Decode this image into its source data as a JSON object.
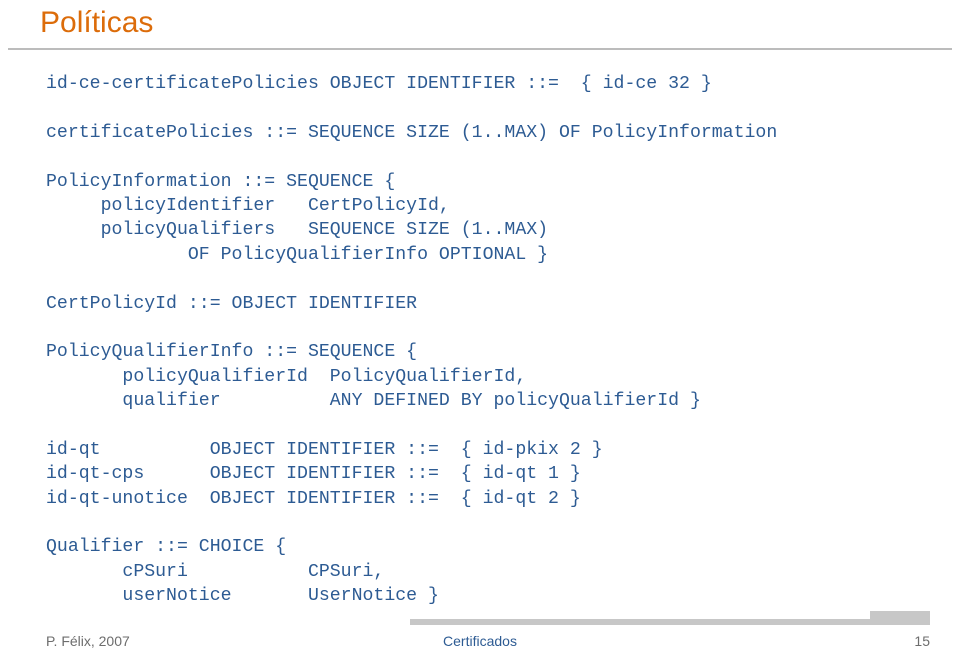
{
  "title": "Políticas",
  "code": "id-ce-certificatePolicies OBJECT IDENTIFIER ::=  { id-ce 32 }\n\ncertificatePolicies ::= SEQUENCE SIZE (1..MAX) OF PolicyInformation\n\nPolicyInformation ::= SEQUENCE {\n     policyIdentifier   CertPolicyId,\n     policyQualifiers   SEQUENCE SIZE (1..MAX)\n             OF PolicyQualifierInfo OPTIONAL }\n\nCertPolicyId ::= OBJECT IDENTIFIER\n\nPolicyQualifierInfo ::= SEQUENCE {\n       policyQualifierId  PolicyQualifierId,\n       qualifier          ANY DEFINED BY policyQualifierId }\n\nid-qt          OBJECT IDENTIFIER ::=  { id-pkix 2 }\nid-qt-cps      OBJECT IDENTIFIER ::=  { id-qt 1 }\nid-qt-unotice  OBJECT IDENTIFIER ::=  { id-qt 2 }\n\nQualifier ::= CHOICE {\n       cPSuri           CPSuri,\n       userNotice       UserNotice }",
  "footer": {
    "left": "P. Félix, 2007",
    "center": "Certificados",
    "right": "15"
  }
}
